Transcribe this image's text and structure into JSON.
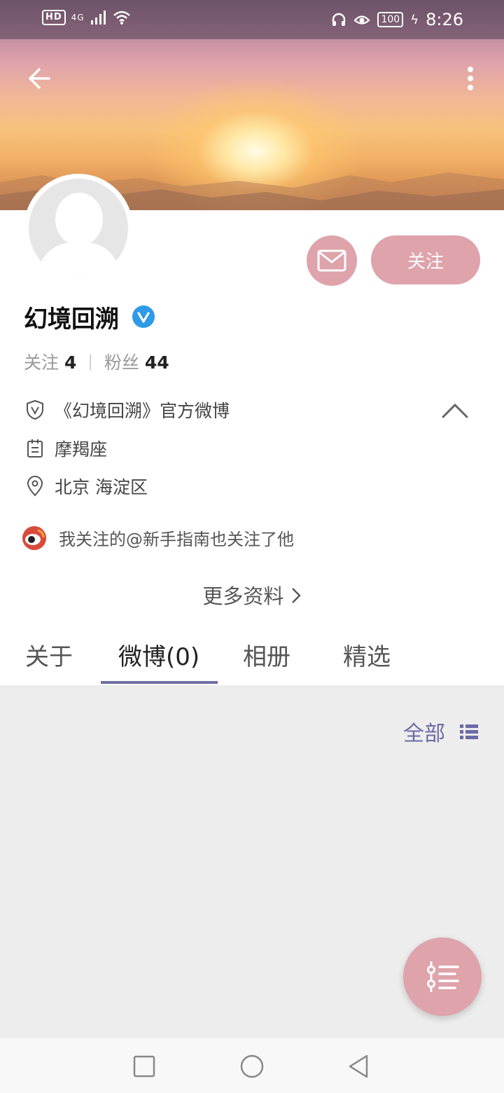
{
  "statusbar": {
    "left_indicators": "4G",
    "hd": "HD",
    "battery": "100",
    "time": "8:26"
  },
  "header": {
    "icons": [
      "back-arrow-icon",
      "more-vertical-icon"
    ]
  },
  "profile": {
    "name": "幻境回溯",
    "follow_button": "关注",
    "following_label": "关注",
    "following_count": "4",
    "separator": "|",
    "fans_label": "粉丝",
    "fans_count": "44",
    "verified_icon": "verified-v-icon"
  },
  "info": {
    "verification": "《幻境回溯》官方微博",
    "zodiac": "摩羯座",
    "location": "北京 海淀区",
    "mutual": "我关注的@新手指南也关注了他",
    "more": "更多资料"
  },
  "tabs": [
    {
      "label": "关于"
    },
    {
      "label": "微博(0)"
    },
    {
      "label": "相册"
    },
    {
      "label": "精选"
    }
  ],
  "filter": {
    "label": "全部"
  },
  "colors": {
    "accent_pink": "#dea3ab",
    "tab_underline": "#6f6fa3",
    "filter_text": "#6a6aa8",
    "verified_blue": "#2f9ae6",
    "content_bg": "#ededed"
  }
}
